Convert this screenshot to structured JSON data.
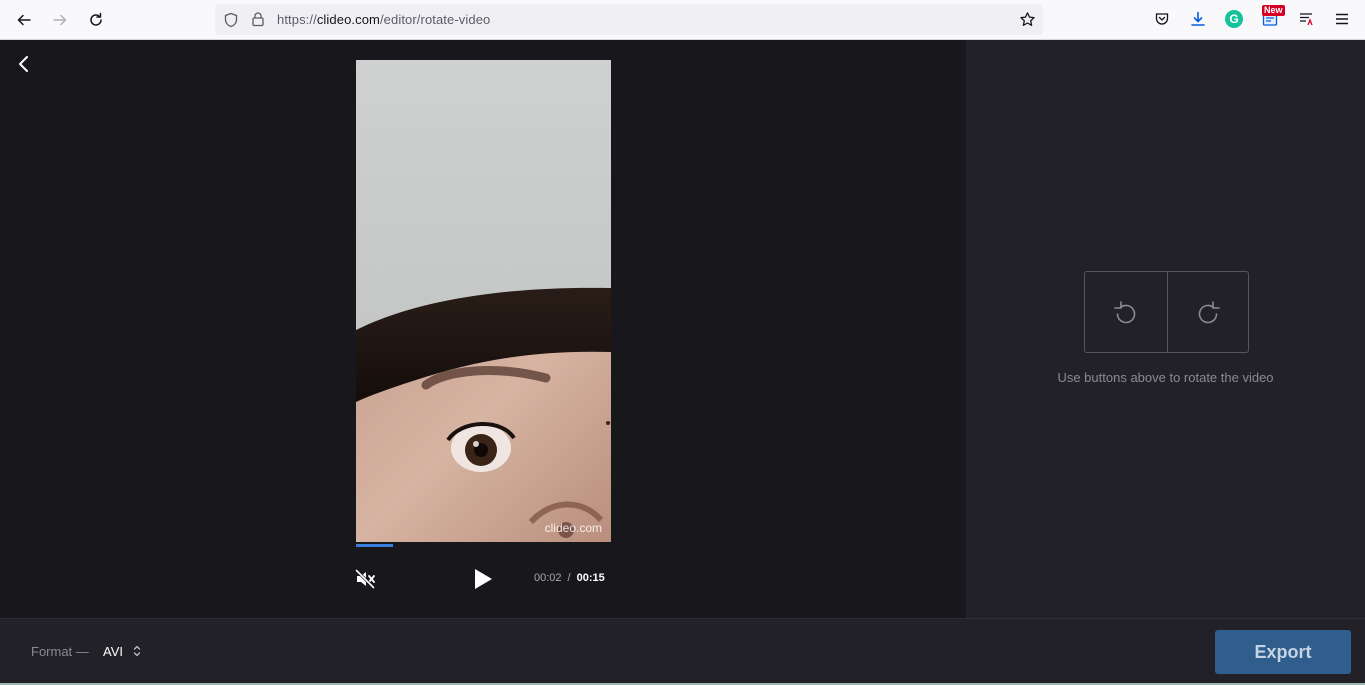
{
  "browser": {
    "url_prefix": "https://",
    "url_host": "clideo.com",
    "url_path": "/editor/rotate-video",
    "new_badge": "New",
    "grammarly_letter": "G",
    "icons": [
      "back-icon",
      "forward-icon",
      "reload-icon",
      "shield-icon",
      "lock-icon",
      "bookmark-star-icon",
      "pocket-icon",
      "download-icon",
      "grammarly-icon",
      "extension-icon",
      "reader-icon",
      "menu-icon"
    ]
  },
  "editor": {
    "watermark": "clideo.com",
    "playback": {
      "current_time": "00:02",
      "separator": "/",
      "total_time": "00:15",
      "progress_fraction": 0.145,
      "muted": true
    },
    "rotate": {
      "hint": "Use buttons above to rotate the video"
    },
    "format": {
      "label": "Format —",
      "value": "AVI"
    },
    "export_label": "Export"
  },
  "colors": {
    "accent": "#3b7ddd",
    "export_button": "#2f5d8c",
    "panel": "#212127",
    "background": "#17171c"
  }
}
